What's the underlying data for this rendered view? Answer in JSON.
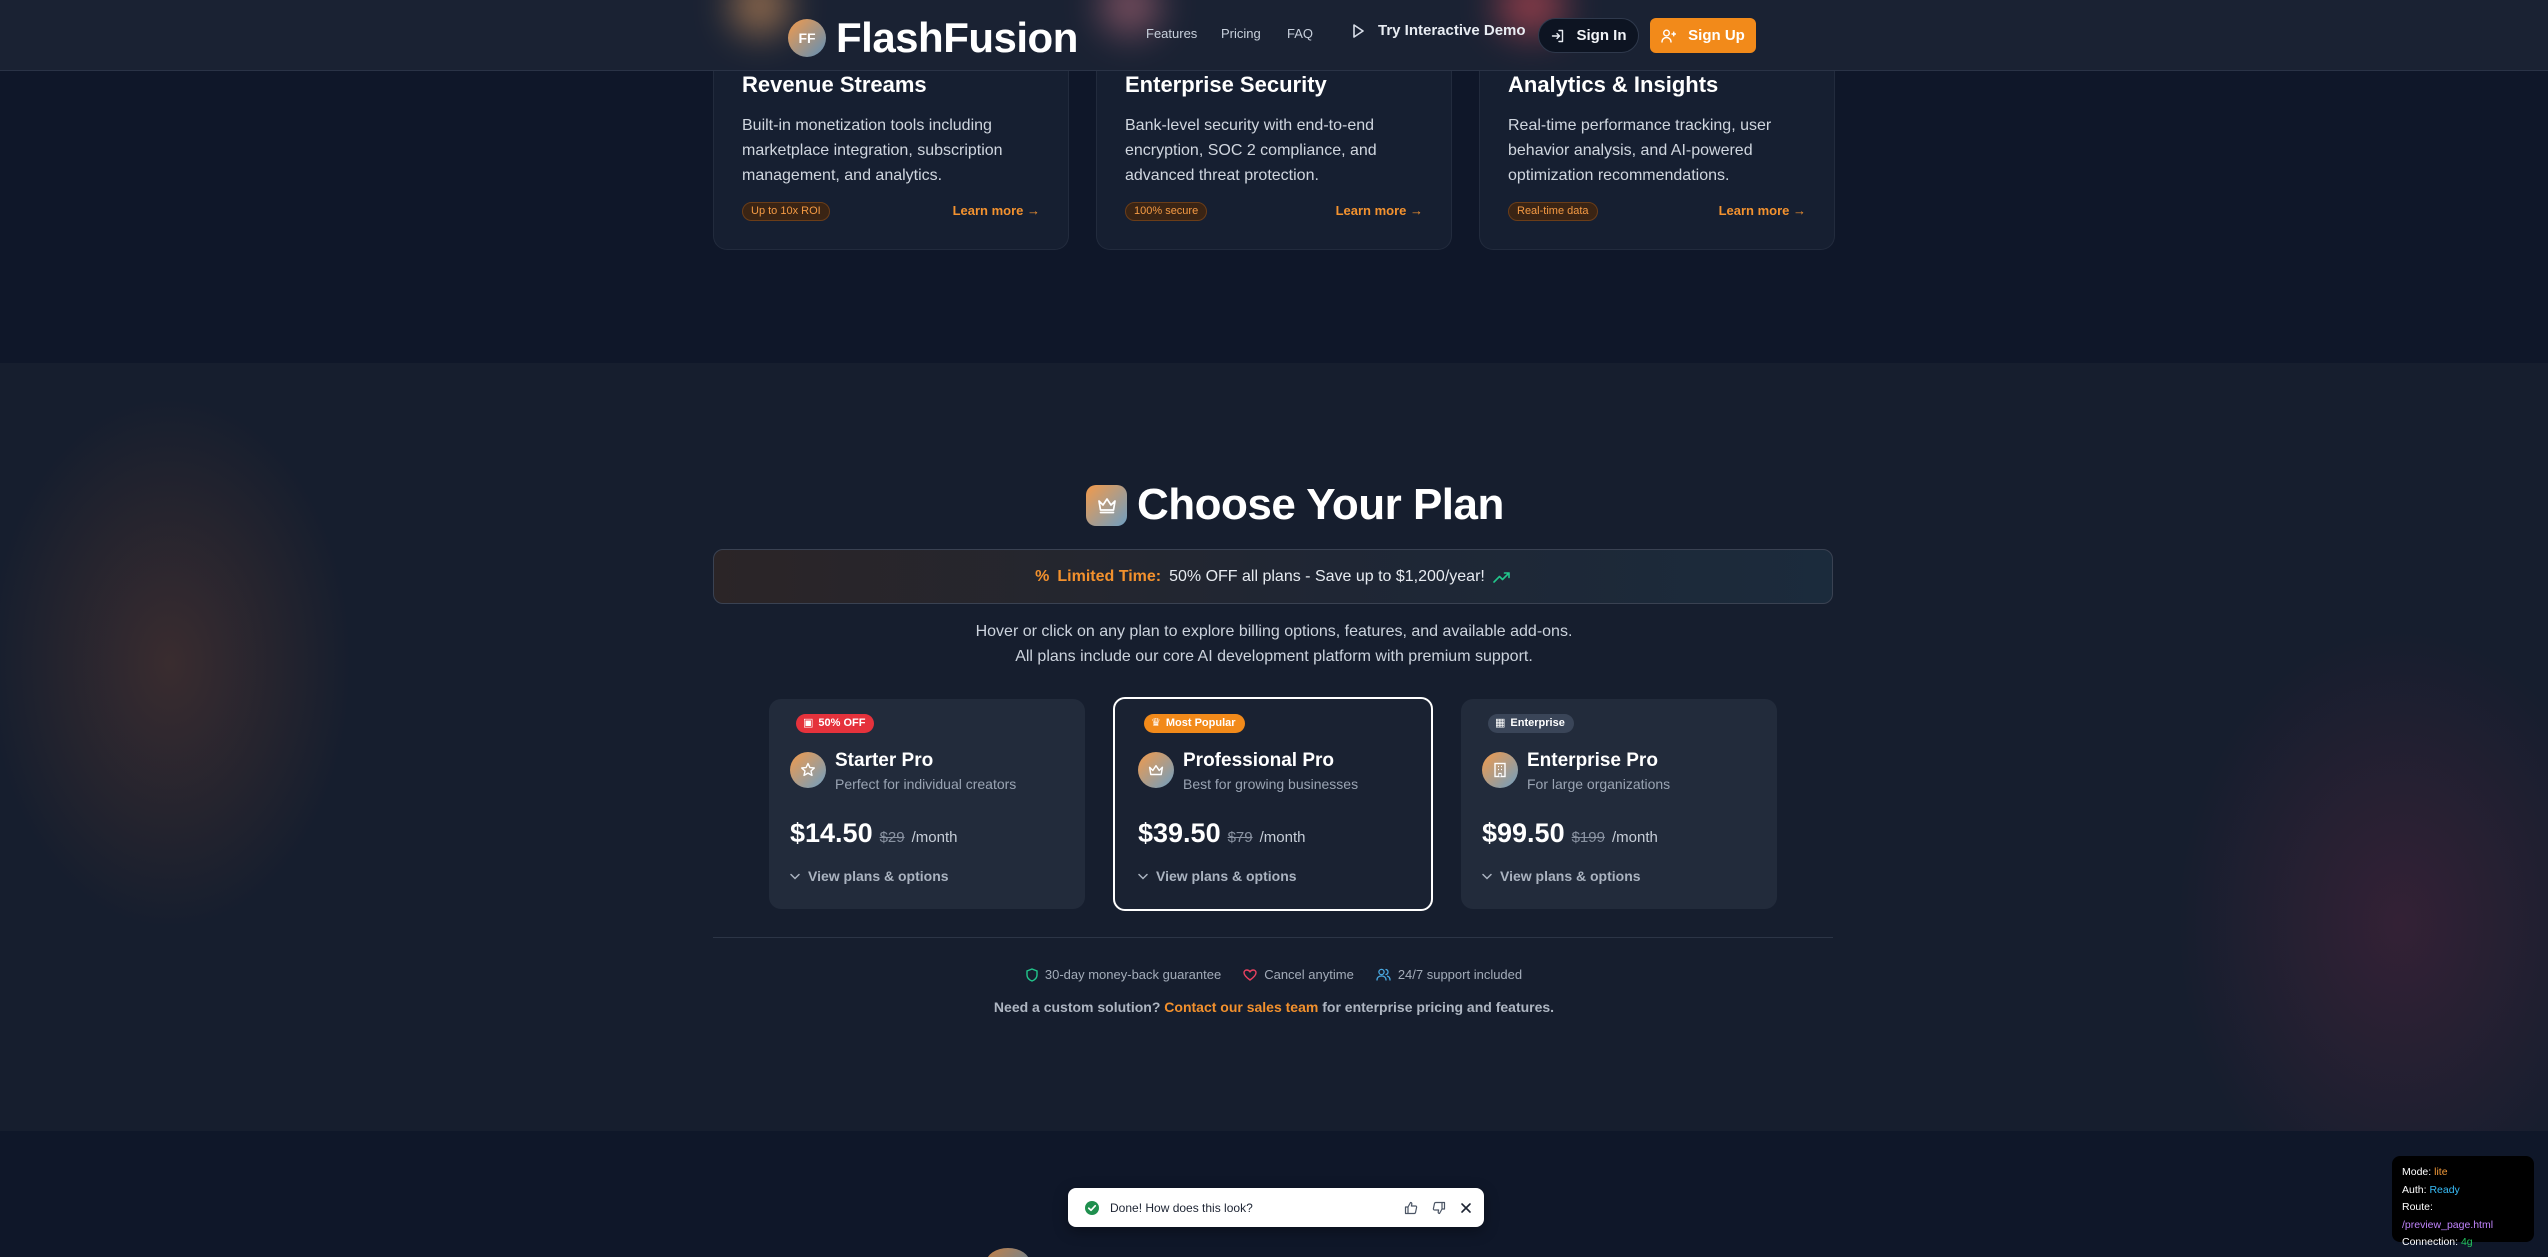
{
  "header": {
    "logo_initials": "FF",
    "brand": "FlashFusion",
    "nav": [
      "Features",
      "Pricing",
      "FAQ"
    ],
    "demo_label": "Try Interactive Demo",
    "signin_label": "Sign In",
    "signup_label": "Sign Up",
    "accent": "#f28a1a"
  },
  "features": [
    {
      "title": "Revenue Streams",
      "description": "Built-in monetization tools including marketplace integration, subscription management, and analytics.",
      "badge": "Up to 10x ROI",
      "link": "Learn more"
    },
    {
      "title": "Enterprise Security",
      "description": "Bank-level security with end-to-end encryption, SOC 2 compliance, and advanced threat protection.",
      "badge": "100% secure",
      "link": "Learn more"
    },
    {
      "title": "Analytics & Insights",
      "description": "Real-time performance tracking, user behavior analysis, and AI-powered optimization recommendations.",
      "badge": "Real-time data",
      "link": "Learn more"
    }
  ],
  "pricing": {
    "title": "Choose Your Plan",
    "promo_strong": "Limited Time:",
    "promo_text": "50% OFF all plans - Save up to $1,200/year!",
    "sub_line_1": "Hover or click on any plan to explore billing options, features, and available add-ons.",
    "sub_line_2": "All plans include our core AI development platform with premium support.",
    "plans": [
      {
        "badge": "50% OFF",
        "badge_color": "#e5323c",
        "icon": "star-icon",
        "name": "Starter Pro",
        "tagline": "Perfect for individual creators",
        "price": "$14.50",
        "old_price": "$29",
        "period": "/month",
        "link": "View plans & options"
      },
      {
        "badge": "Most Popular",
        "badge_color": "#f28a1a",
        "icon": "crown-icon",
        "name": "Professional Pro",
        "tagline": "Best for growing businesses",
        "price": "$39.50",
        "old_price": "$79",
        "period": "/month",
        "link": "View plans & options"
      },
      {
        "badge": "Enterprise",
        "badge_color": "#3a4558",
        "icon": "building-icon",
        "name": "Enterprise Pro",
        "tagline": "For large organizations",
        "price": "$99.50",
        "old_price": "$199",
        "period": "/month",
        "link": "View plans & options"
      }
    ],
    "guarantees": [
      "30-day money-back guarantee",
      "Cancel anytime",
      "24/7 support included"
    ],
    "custom_prefix": "Need a custom solution?",
    "custom_link": "Contact our sales team",
    "custom_suffix": "for enterprise pricing and features."
  },
  "feedback": {
    "text": "Done! How does this look?"
  },
  "status": {
    "mode_label": "Mode:",
    "mode_value": "lite",
    "auth_label": "Auth:",
    "auth_value": "Ready",
    "route_label": "Route:",
    "route_value": "/preview_page.html",
    "connection_label": "Connection:",
    "connection_value": "4g"
  }
}
